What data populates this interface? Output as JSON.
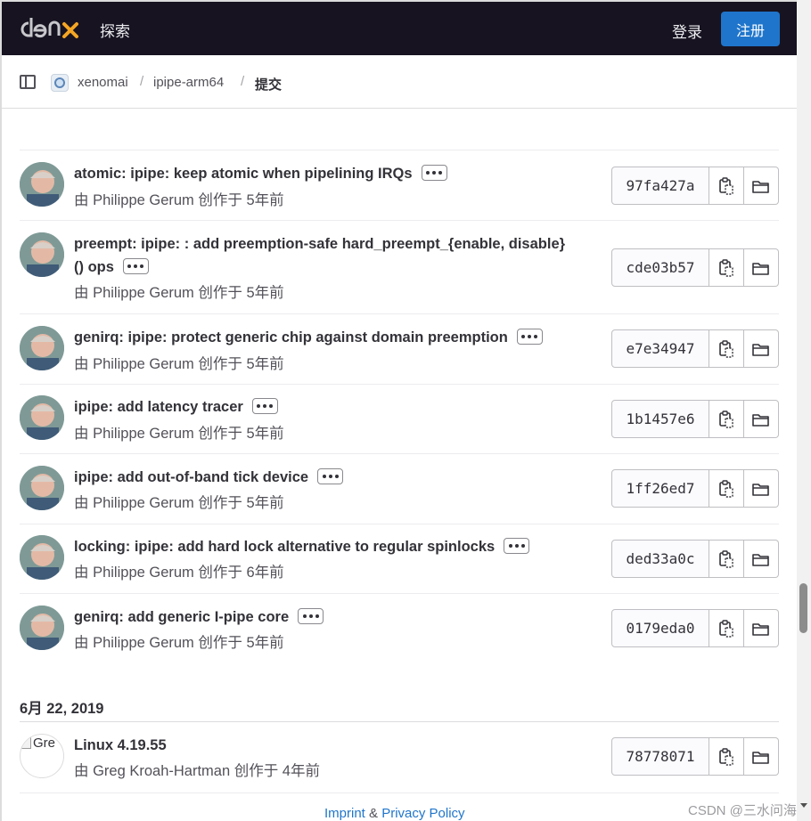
{
  "header": {
    "logo_text": "denx",
    "explore": "探索",
    "login": "登录",
    "register": "注册"
  },
  "breadcrumb": {
    "group": "xenomai",
    "project": "ipipe-arm64",
    "current": "提交",
    "separator": "/"
  },
  "commits": [
    {
      "title": "atomic: ipipe: keep atomic when pipelining IRQs",
      "author": "由 Philippe Gerum 创作于 5年前",
      "sha": "97fa427a"
    },
    {
      "title": "preempt: ipipe: : add preemption-safe hard_preempt_{enable, disable}() ops",
      "author": "由 Philippe Gerum 创作于 5年前",
      "sha": "cde03b57"
    },
    {
      "title": "genirq: ipipe: protect generic chip against domain preemption",
      "author": "由 Philippe Gerum 创作于 5年前",
      "sha": "e7e34947"
    },
    {
      "title": "ipipe: add latency tracer",
      "author": "由 Philippe Gerum 创作于 5年前",
      "sha": "1b1457e6"
    },
    {
      "title": "ipipe: add out-of-band tick device",
      "author": "由 Philippe Gerum 创作于 5年前",
      "sha": "1ff26ed7"
    },
    {
      "title": "locking: ipipe: add hard lock alternative to regular spinlocks",
      "author": "由 Philippe Gerum 创作于 6年前",
      "sha": "ded33a0c"
    },
    {
      "title": "genirq: add generic I-pipe core",
      "author": "由 Philippe Gerum 创作于 5年前",
      "sha": "0179eda0"
    }
  ],
  "date_group": "6月 22, 2019",
  "commit_last": {
    "avatar_alt": "Gre",
    "title": "Linux 4.19.55",
    "author": "由 Greg Kroah-Hartman 创作于 4年前",
    "sha": "78778071"
  },
  "footer": {
    "imprint": "Imprint",
    "amp": "&",
    "privacy": "Privacy Policy"
  },
  "watermark": "CSDN @三水问海",
  "icons": {
    "copy": "clipboard-icon",
    "browse": "folder-icon",
    "more": "ellipsis-icon"
  },
  "colors": {
    "topbar": "#171321",
    "register_button": "#1f75cb",
    "logo_accent": "#f5a623"
  }
}
